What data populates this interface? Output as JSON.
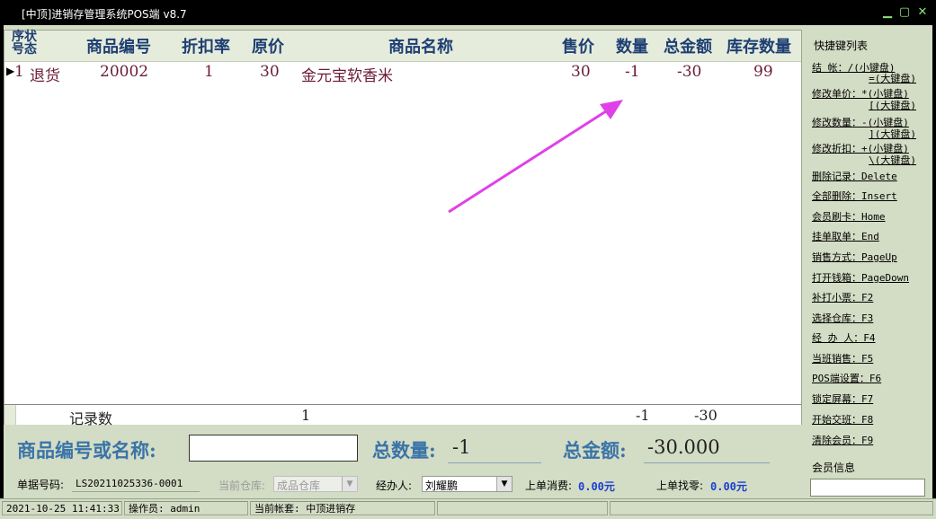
{
  "window": {
    "title": "[中顶]进销存管理系统POS端 v8.7"
  },
  "grid": {
    "columns": {
      "seq_top": "序",
      "seq_bottom": "号",
      "status_top": "状",
      "status_bottom": "态",
      "code": "商品编号",
      "discount": "折扣率",
      "orig_price": "原价",
      "name": "商品名称",
      "sale_price": "售价",
      "qty": "数量",
      "total": "总金额",
      "stock": "库存数量"
    },
    "rows": [
      {
        "seq": "1",
        "status": "退货",
        "code": "20002",
        "discount": "1",
        "orig_price": "30",
        "name": "金元宝软香米",
        "sale_price": "30",
        "qty": "-1",
        "total": "-30",
        "stock": "99"
      }
    ],
    "summary": {
      "label": "记录数",
      "count": "1",
      "qty": "-1",
      "total": "-30"
    }
  },
  "shortcuts": {
    "title": "快捷键列表",
    "items": [
      {
        "label": "结    帐：/(小键盘)"
      },
      {
        "label": "=(大键盘)"
      },
      {
        "label": "修改单价：*(小键盘)"
      },
      {
        "label": "[(大键盘)"
      },
      {
        "label": "修改数量：-(小键盘)"
      },
      {
        "label": "](大键盘)"
      },
      {
        "label": "修改折扣：+(小键盘)"
      },
      {
        "label": "\\(大键盘)"
      },
      {
        "label": "删除记录：Delete"
      },
      {
        "label": "全部删除：Insert"
      },
      {
        "label": "会员刷卡：Home"
      },
      {
        "label": "挂单取单：End"
      },
      {
        "label": "销售方式：PageUp"
      },
      {
        "label": "打开钱箱：PageDown"
      },
      {
        "label": "补打小票：F2"
      },
      {
        "label": "选择仓库：F3"
      },
      {
        "label": "经 办 人：F4"
      },
      {
        "label": "当班销售：F5"
      },
      {
        "label": "POS端设置：F6"
      },
      {
        "label": "锁定屏幕：F7"
      },
      {
        "label": "开始交班：F8"
      },
      {
        "label": "清除会员：F9"
      }
    ]
  },
  "member": {
    "label": "会员信息",
    "value": ""
  },
  "entry": {
    "code_label": "商品编号或名称:",
    "code_value": "",
    "total_qty_label": "总数量:",
    "total_qty": "-1",
    "total_amount_label": "总金额:",
    "total_amount": "-30.000"
  },
  "order": {
    "number_label": "单据号码:",
    "number": "LS20211025336-0001",
    "warehouse_label": "当前仓库:",
    "warehouse": "成品仓库",
    "handler_label": "经办人:",
    "handler": "刘耀鹏",
    "last_spend_label": "上单消费:",
    "last_spend": "0.00元",
    "last_change_label": "上单找零:",
    "last_change": "0.00元"
  },
  "status": {
    "datetime": "2021-10-25 11:41:33",
    "operator_label": "操作员:",
    "operator": "admin",
    "account_label": "当前帐套:",
    "account": "中顶进销存"
  },
  "colors": {
    "arrow": "#e040e8",
    "header_text": "#1e3f73",
    "row_text": "#6b1b38",
    "big_label": "#3a74a8",
    "panel_bg": "#d3dcc4"
  }
}
